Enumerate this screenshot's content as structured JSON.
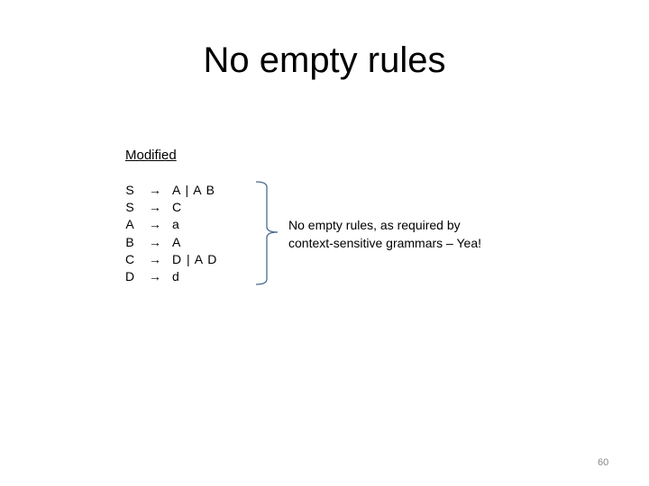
{
  "slide": {
    "title": "No empty rules",
    "subheading": "Modified",
    "rules": [
      {
        "lhs": "S",
        "arrow": "→",
        "rhs": "A | A B"
      },
      {
        "lhs": "S",
        "arrow": "→",
        "rhs": "C"
      },
      {
        "lhs": "A",
        "arrow": "→",
        "rhs": "a"
      },
      {
        "lhs": "B",
        "arrow": "→",
        "rhs": "A"
      },
      {
        "lhs": "C",
        "arrow": "→",
        "rhs": "D | A D"
      },
      {
        "lhs": "D",
        "arrow": "→",
        "rhs": "d"
      }
    ],
    "note_lines": [
      "No empty rules, as required by",
      "context-sensitive grammars – Yea!"
    ],
    "page_number": "60",
    "brace_color": "#4a6a90"
  }
}
